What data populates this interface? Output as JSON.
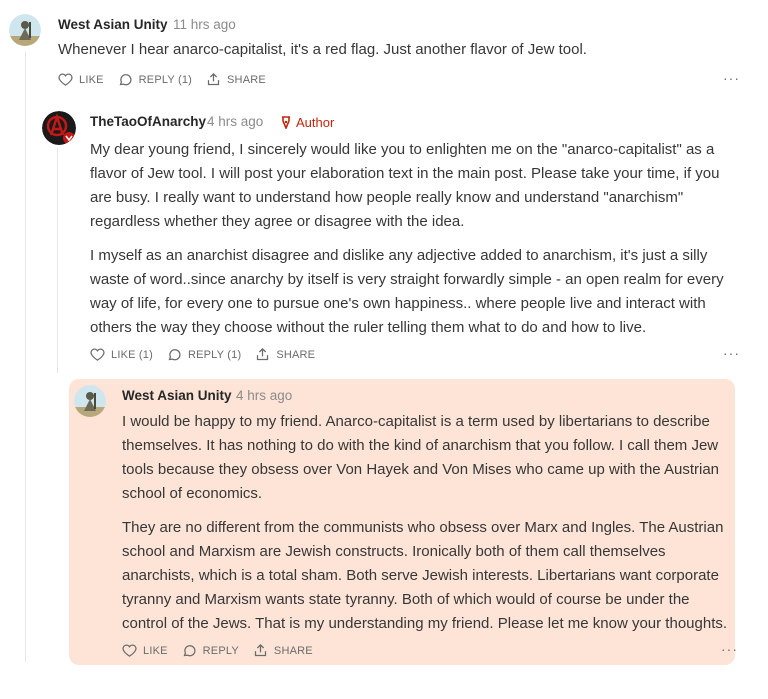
{
  "comments": [
    {
      "author": "West Asian Unity",
      "time": "11 hrs ago",
      "paragraphs": [
        "Whenever I hear anarco-capitalist, it's a red flag. Just another flavor of Jew tool."
      ],
      "like_label": "LIKE",
      "reply_label": "REPLY (1)",
      "share_label": "SHARE",
      "more": "···"
    },
    {
      "author": "TheTaoOfAnarchy",
      "time": "4 hrs ago",
      "badge": "Author",
      "paragraphs": [
        "My dear young friend, I sincerely would like you to enlighten me on the \"anarco-capitalist\" as a flavor of Jew tool. I will post your elaboration text in the main post. Please take your time, if you are busy. I really want to understand how people really know and understand \"anarchism\" regardless whether they agree or disagree with the idea.",
        "I myself as an anarchist disagree and dislike any adjective added to anarchism, it's just a silly waste of word..since anarchy by itself is very straight forwardly simple - an open realm for every way of life, for every one to pursue one's own happiness.. where people live and interact with others the way they choose without the ruler telling them what to do and how to live."
      ],
      "like_label": "LIKE (1)",
      "reply_label": "REPLY (1)",
      "share_label": "SHARE",
      "more": "···"
    },
    {
      "author": "West Asian Unity",
      "time": "4 hrs ago",
      "paragraphs": [
        "I would be happy to my friend. Anarco-capitalist is a term used by libertarians to describe themselves. It has nothing to do with the kind of anarchism that you follow. I call them Jew tools because they obsess over Von Hayek and Von Mises who came up with the Austrian school of economics.",
        "They are no different from the communists who obsess over Marx and Ingles. The Austrian school and Marxism are Jewish constructs. Ironically both of them call themselves anarchists, which is a total sham. Both serve Jewish interests. Libertarians want corporate tyranny and Marxism wants state tyranny. Both of which would of course be under the control of the Jews. That is my understanding my friend. Please let me know your thoughts."
      ],
      "like_label": "LIKE",
      "reply_label": "REPLY",
      "share_label": "SHARE",
      "more": "···"
    }
  ],
  "colors": {
    "author_badge": "#c2260c",
    "highlight_bg": "#fde4d7",
    "thread_line": "#e6e6e6"
  }
}
